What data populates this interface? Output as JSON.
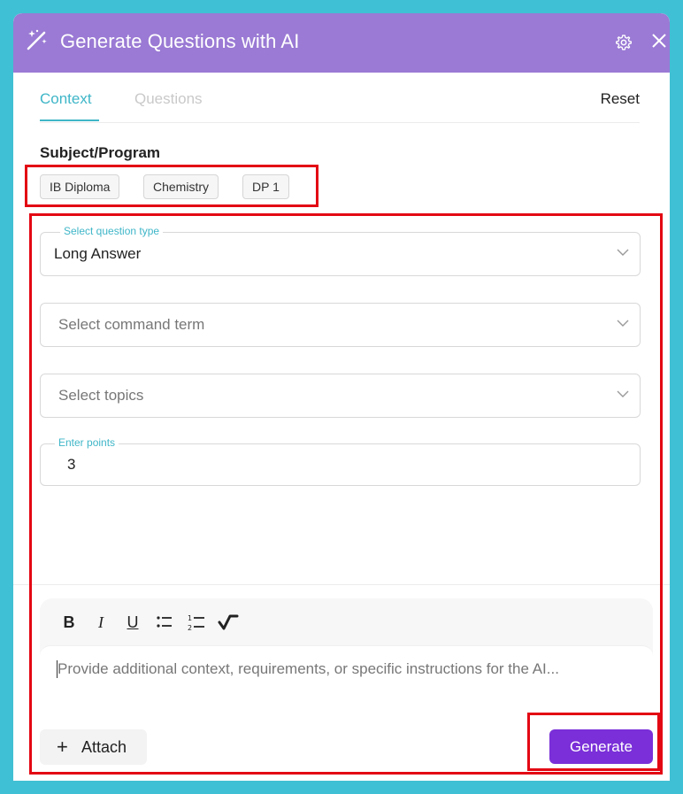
{
  "header": {
    "title": "Generate Questions with AI",
    "icon": "magic-wand-icon",
    "settings_icon": "gear-icon",
    "close_icon": "close-icon",
    "color": "#9a7ad4"
  },
  "tabs": [
    {
      "label": "Context",
      "active": true
    },
    {
      "label": "Questions",
      "active": false
    }
  ],
  "reset_label": "Reset",
  "subject": {
    "label": "Subject/Program",
    "chips": [
      "IB Diploma",
      "Chemistry",
      "DP 1"
    ]
  },
  "fields": {
    "question_type": {
      "legend": "Select question type",
      "value": "Long Answer"
    },
    "command_term": {
      "placeholder": "Select command term"
    },
    "topics": {
      "placeholder": "Select topics"
    },
    "points": {
      "legend": "Enter points",
      "value": "3"
    }
  },
  "editor": {
    "toolbar": [
      "bold-icon",
      "italic-icon",
      "underline-icon",
      "bullet-list-icon",
      "numbered-list-icon",
      "equation-icon"
    ],
    "placeholder": "Provide additional context, requirements, or specific instructions for the AI..."
  },
  "attach_label": "Attach",
  "generate_label": "Generate",
  "colors": {
    "accent": "#3fb6c8",
    "primary_button": "#7a2fd8",
    "highlight": "#e30613",
    "background": "#40c0d4"
  }
}
